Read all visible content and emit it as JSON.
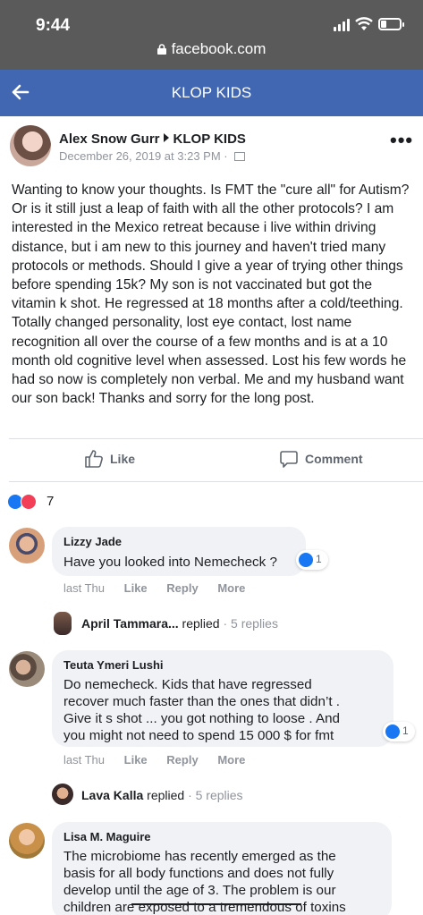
{
  "status": {
    "time": "9:44",
    "url": "facebook.com"
  },
  "header": {
    "title": "KLOP KIDS",
    "back_icon": "back-arrow-icon"
  },
  "post": {
    "author": "Alex Snow Gurr",
    "group": "KLOP KIDS",
    "date": "December 26, 2019 at 3:23 PM · ",
    "text": "Wanting to know your thoughts. Is FMT the \"cure all\" for Autism? Or is it still just a leap of faith with all the other protocols? I am interested in the Mexico retreat because i live within driving distance, but i am new to this journey and haven't tried many protocols or methods. Should I give a year of trying other things before spending 15k? My son is not vaccinated but got the vitamin k shot. He regressed at 18 months after a cold/teething. Totally changed personality, lost eye contact, lost name recognition all over the course of a few months and is at a 10 month old cognitive level when assessed. Lost his few words he had so now is completely non verbal. Me and my husband want our son back! Thanks and sorry for the long post.",
    "like_label": "Like",
    "comment_label": "Comment",
    "reaction_count": "7",
    "colors": {
      "brand": "#4267b2",
      "like": "#1877f2",
      "love": "#f33e58"
    }
  },
  "comments": [
    {
      "name": "Lizzy Jade",
      "text": "Have you looked into Nemecheck ?",
      "reaction_count": "1",
      "time": "last Thu",
      "like": "Like",
      "reply": "Reply",
      "more": "More",
      "replies": {
        "name": "April Tammara...",
        "action": " replied",
        "count": " · 5 replies"
      }
    },
    {
      "name": "Teuta Ymeri Lushi",
      "text_lines": [
        "Do nemecheck. Kids that have regressed",
        "recover much faster than the ones that didn’t .",
        "Give it s shot ... you got nothing to loose . And",
        "you might not need to spend 15 000 $ for fmt"
      ],
      "reaction_count": "1",
      "time": "last Thu",
      "like": "Like",
      "reply": "Reply",
      "more": "More",
      "replies": {
        "name": "Lava Kalla",
        "action": " replied",
        "count": " · 5 replies"
      }
    },
    {
      "name": "Lisa M. Maguire",
      "text_lines": [
        "The microbiome has recently emerged as the",
        "basis for all body functions and does not fully",
        "develop until the age of 3. The problem is our",
        "children are exposed to a tremendous of toxins"
      ]
    }
  ]
}
